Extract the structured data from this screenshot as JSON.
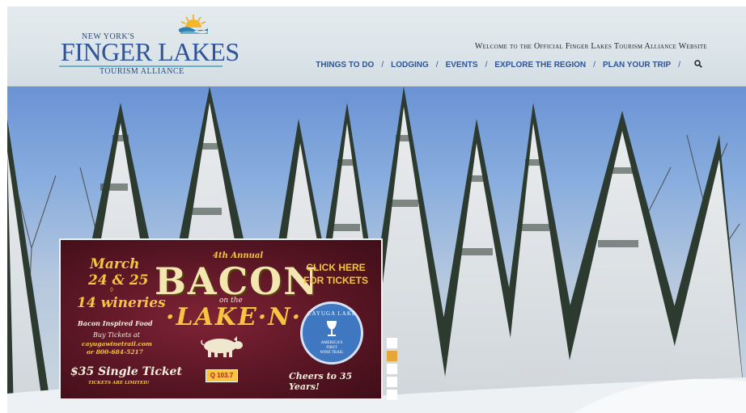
{
  "header": {
    "logo": {
      "top": "New York's",
      "main": "Finger Lakes",
      "sub": "Tourism Alliance",
      "icon": "sun-over-water-icon"
    },
    "welcome": "Welcome to the Official Finger Lakes Tourism Alliance Website",
    "nav": [
      {
        "label": "THINGS TO DO"
      },
      {
        "label": "LODGING"
      },
      {
        "label": "EVENTS"
      },
      {
        "label": "EXPLORE THE REGION"
      },
      {
        "label": "PLAN YOUR TRIP"
      }
    ],
    "separator": "/",
    "search_icon": "search-icon"
  },
  "colors": {
    "nav_blue": "#2f5597",
    "ad_gold": "#f5c542",
    "ad_maroon": "#5a1624",
    "active_dot": "#e6a73a"
  },
  "ad": {
    "march": "March",
    "dates": "24 & 25",
    "diamond": "◊",
    "wineries": "14 wineries",
    "bacon_food": "Bacon Inspired Food",
    "buy": "Buy Tickets at",
    "site": "cayugawinetrail.com",
    "phone": "or 800-684-5217",
    "single": "$35 Single Ticket",
    "limited": "TICKETS ARE LIMITED!",
    "annual": "4th Annual",
    "title": "BACON",
    "on_the": "on the",
    "lake": "·LAKE·N·",
    "click_here": "CLICK HERE",
    "for_tickets": "FOR TICKETS",
    "seal_top": "CAYUGA LAKE",
    "seal_mid_1": "AMERICA'S",
    "seal_mid_2": "FIRST",
    "seal_bot": "WINE TRAIL",
    "cheers": "Cheers to 35 Years!",
    "radio": "Q 103.7"
  },
  "slider": {
    "count": 5,
    "active_index": 1
  }
}
